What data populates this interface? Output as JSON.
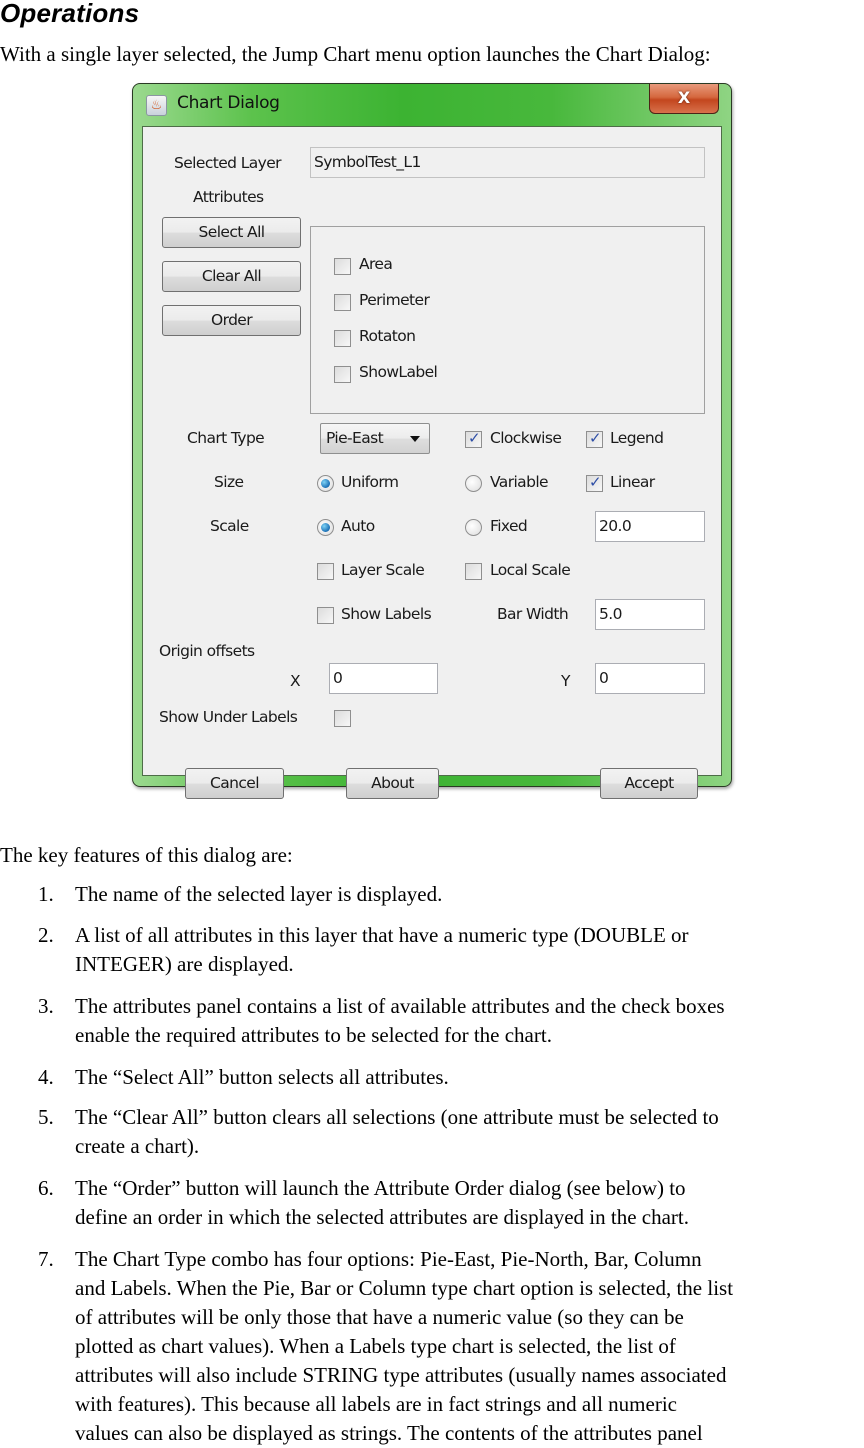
{
  "document": {
    "heading": "Operations",
    "intro": "With a single layer selected, the Jump Chart menu option launches the Chart Dialog:",
    "features_intro": "The key features of this dialog are:",
    "features": [
      {
        "num": "1.",
        "lines": [
          "The name of the selected layer is displayed."
        ]
      },
      {
        "num": "2.",
        "lines": [
          "A list of all attributes in this layer that have a numeric type (DOUBLE or",
          "INTEGER) are displayed."
        ]
      },
      {
        "num": "3.",
        "lines": [
          "The attributes panel contains a list of available attributes and the check boxes",
          "enable the required attributes to be selected for the chart."
        ]
      },
      {
        "num": "4.",
        "lines": [
          "The “Select All” button selects all attributes."
        ]
      },
      {
        "num": "5.",
        "lines": [
          "The “Clear All” button clears all selections (one attribute must be selected to",
          "create a chart)."
        ]
      },
      {
        "num": "6.",
        "lines": [
          "The “Order” button will launch the Attribute Order dialog (see below) to",
          "define an order in which the selected attributes are displayed in the chart."
        ]
      },
      {
        "num": "7.",
        "lines": [
          "The Chart Type combo has four options: Pie-East, Pie-North, Bar, Column",
          "and Labels.  When the Pie, Bar or Column type chart option is selected, the list",
          "of attributes will be only those that have a numeric value (so they can be",
          "plotted as chart values).  When a Labels type chart is selected, the list of",
          "attributes will also include STRING type attributes (usually names associated",
          "with features).  This because all labels are in fact strings and all numeric",
          "values can also be displayed as strings.  The contents of the attributes panel"
        ]
      }
    ]
  },
  "dialog": {
    "title": "Chart Dialog",
    "icon": "java-cup-icon",
    "close_label": "X",
    "selected_layer_label": "Selected Layer",
    "selected_layer_value": "SymbolTest_L1",
    "attributes_label": "Attributes",
    "buttons": {
      "select_all": "Select All",
      "clear_all": "Clear All",
      "order": "Order",
      "cancel": "Cancel",
      "about": "About",
      "accept": "Accept"
    },
    "attributes": [
      {
        "label": "Area",
        "checked": false
      },
      {
        "label": "Perimeter",
        "checked": false
      },
      {
        "label": "Rotaton",
        "checked": false
      },
      {
        "label": "ShowLabel",
        "checked": false
      }
    ],
    "chart_type_label": "Chart Type",
    "chart_type_value": "Pie-East",
    "clockwise": {
      "label": "Clockwise",
      "checked": true
    },
    "legend": {
      "label": "Legend",
      "checked": true
    },
    "size_label": "Size",
    "size_options": [
      {
        "label": "Uniform",
        "checked": true
      },
      {
        "label": "Variable",
        "checked": false
      }
    ],
    "linear": {
      "label": "Linear",
      "checked": true
    },
    "scale_label": "Scale",
    "scale_options": [
      {
        "label": "Auto",
        "checked": true
      },
      {
        "label": "Fixed",
        "checked": false
      }
    ],
    "scale_value": "20.0",
    "layer_scale": {
      "label": "Layer Scale",
      "checked": false
    },
    "local_scale": {
      "label": "Local Scale",
      "checked": false
    },
    "show_labels": {
      "label": "Show Labels",
      "checked": false
    },
    "bar_width_label": "Bar Width",
    "bar_width_value": "5.0",
    "origin_offsets_label": "Origin offsets",
    "x_label": "X",
    "x_value": "0",
    "y_label": "Y",
    "y_value": "0",
    "show_under_labels": {
      "label": "Show Under Labels",
      "checked": false
    }
  },
  "colors": {
    "title_bar": "#3cb332",
    "close_button": "#c3461e",
    "client_bg": "#f0f0f0",
    "check_tick": "#2f4fa6",
    "radio_dot": "#1a6fb5"
  }
}
